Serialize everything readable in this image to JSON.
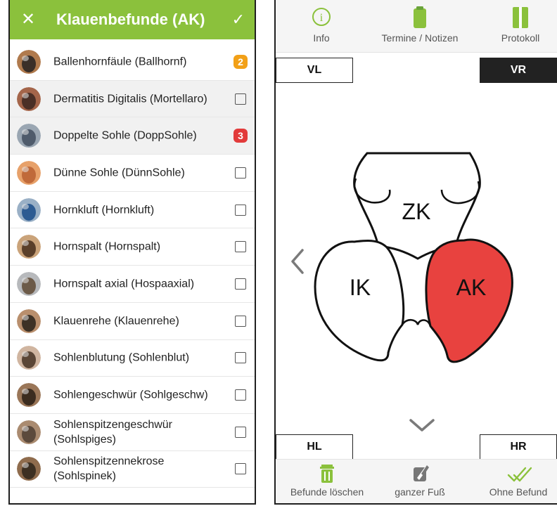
{
  "left_panel": {
    "header": {
      "close_icon": "close-icon",
      "title": "Klauenbefunde (AK)",
      "confirm_icon": "check-icon"
    },
    "items": [
      {
        "label": "Ballenhornfäule (Ballhornf)",
        "badge": "2",
        "badge_color": "#f2a017"
      },
      {
        "label": "Dermatitis Digitalis (Mortellaro)",
        "badge": null
      },
      {
        "label": "Doppelte Sohle (DoppSohle)",
        "badge": "3",
        "badge_color": "#e23b3b"
      },
      {
        "label": "Dünne Sohle (DünnSohle)",
        "badge": null
      },
      {
        "label": "Hornkluft (Hornkluft)",
        "badge": null
      },
      {
        "label": "Hornspalt (Hornspalt)",
        "badge": null
      },
      {
        "label": "Hornspalt axial (Hospaaxial)",
        "badge": null
      },
      {
        "label": "Klauenrehe (Klauenrehe)",
        "badge": null
      },
      {
        "label": "Sohlenblutung (Sohlenblut)",
        "badge": null
      },
      {
        "label": "Sohlengeschwür (Sohlgeschw)",
        "badge": null
      },
      {
        "label": "Sohlenspitzengeschwür (Sohlspiges)",
        "badge": null
      },
      {
        "label": "Sohlenspitzennekrose (Sohlspinek)",
        "badge": null
      }
    ]
  },
  "right_panel": {
    "toolbar": {
      "info": "Info",
      "termine": "Termine / Notizen",
      "protokoll": "Protokoll"
    },
    "legs": {
      "vl": "VL",
      "vr": "VR",
      "hl": "HL",
      "hr": "HR"
    },
    "diagram": {
      "zk": "ZK",
      "ik": "IK",
      "ak": "AK",
      "selected_region": "AK",
      "selected_color": "#e8423f"
    },
    "bottom": {
      "delete": "Befunde löschen",
      "whole_foot": "ganzer Fuß",
      "no_finding": "Ohne Befund"
    },
    "colors": {
      "accent": "#8bc13c",
      "accent_dark": "#6aa33a"
    }
  }
}
